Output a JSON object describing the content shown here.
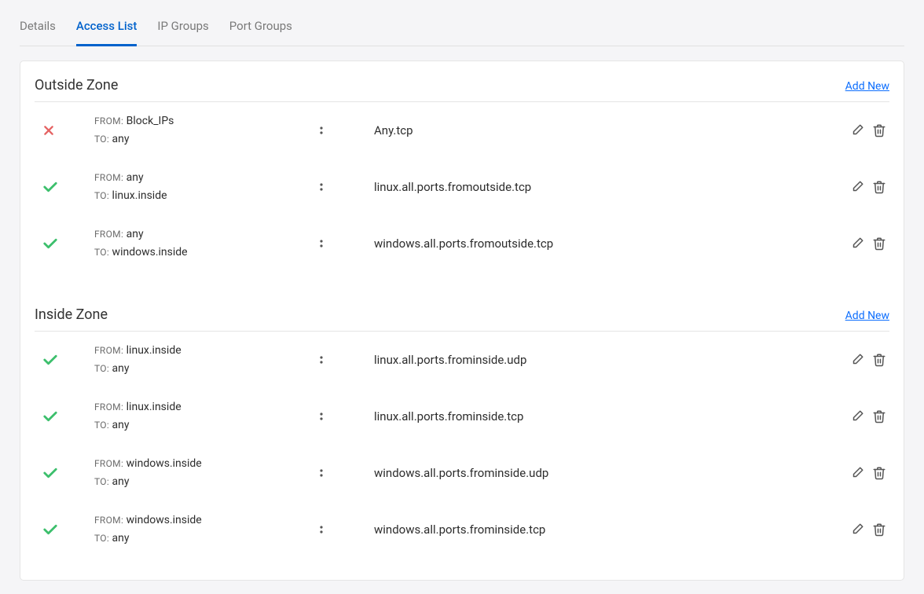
{
  "tabs": {
    "details": "Details",
    "access_list": "Access List",
    "ip_groups": "IP Groups",
    "port_groups": "Port Groups"
  },
  "labels": {
    "from": "FROM:",
    "to": "TO:",
    "add_new": "Add New"
  },
  "zones": {
    "outside": {
      "title": "Outside Zone",
      "rules": [
        {
          "status": "deny",
          "from": "Block_IPs",
          "to": "any",
          "port": "Any.tcp"
        },
        {
          "status": "allow",
          "from": "any",
          "to": "linux.inside",
          "port": "linux.all.ports.fromoutside.tcp"
        },
        {
          "status": "allow",
          "from": "any",
          "to": "windows.inside",
          "port": "windows.all.ports.fromoutside.tcp"
        }
      ]
    },
    "inside": {
      "title": "Inside Zone",
      "rules": [
        {
          "status": "allow",
          "from": "linux.inside",
          "to": "any",
          "port": "linux.all.ports.frominside.udp"
        },
        {
          "status": "allow",
          "from": "linux.inside",
          "to": "any",
          "port": "linux.all.ports.frominside.tcp"
        },
        {
          "status": "allow",
          "from": "windows.inside",
          "to": "any",
          "port": "windows.all.ports.frominside.udp"
        },
        {
          "status": "allow",
          "from": "windows.inside",
          "to": "any",
          "port": "windows.all.ports.frominside.tcp"
        }
      ]
    }
  }
}
